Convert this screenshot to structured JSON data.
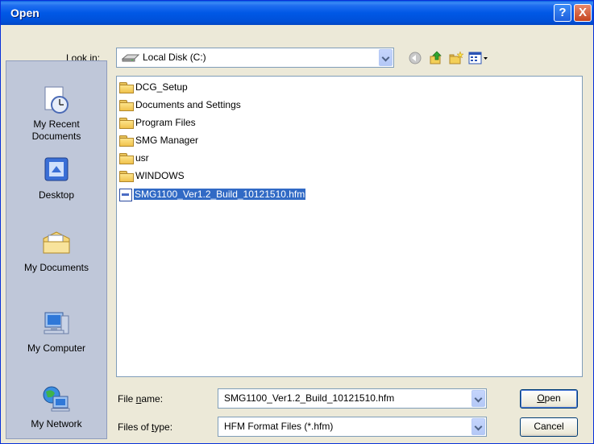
{
  "titlebar": {
    "title": "Open",
    "help_label": "?",
    "close_label": "X"
  },
  "lookin": {
    "label": "Look in:",
    "value": "Local Disk (C:)"
  },
  "places": [
    {
      "label_line1": "My Recent",
      "label_line2": "Documents",
      "icon": "recent-documents-icon"
    },
    {
      "label_line1": "Desktop",
      "label_line2": "",
      "icon": "desktop-icon"
    },
    {
      "label_line1": "My Documents",
      "label_line2": "",
      "icon": "my-documents-icon"
    },
    {
      "label_line1": "My Computer",
      "label_line2": "",
      "icon": "my-computer-icon"
    },
    {
      "label_line1": "My Network",
      "label_line2": "",
      "icon": "my-network-icon"
    }
  ],
  "files": [
    {
      "name": "DCG_Setup",
      "type": "folder"
    },
    {
      "name": "Documents and Settings",
      "type": "folder"
    },
    {
      "name": "Program Files",
      "type": "folder"
    },
    {
      "name": "SMG Manager",
      "type": "folder"
    },
    {
      "name": "usr",
      "type": "folder"
    },
    {
      "name": "WINDOWS",
      "type": "folder"
    },
    {
      "name": "SMG1100_Ver1.2_Build_10121510.hfm",
      "type": "file",
      "selected": true
    }
  ],
  "filename": {
    "label": "File name:",
    "value": "SMG1100_Ver1.2_Build_10121510.hfm"
  },
  "filetype": {
    "label": "Files of type:",
    "value": "HFM Format Files (*.hfm)"
  },
  "buttons": {
    "open": "Open",
    "cancel": "Cancel"
  },
  "colors": {
    "titlebar": "#0058e6",
    "selection": "#316ac5",
    "dialog_bg": "#ece9d8"
  }
}
